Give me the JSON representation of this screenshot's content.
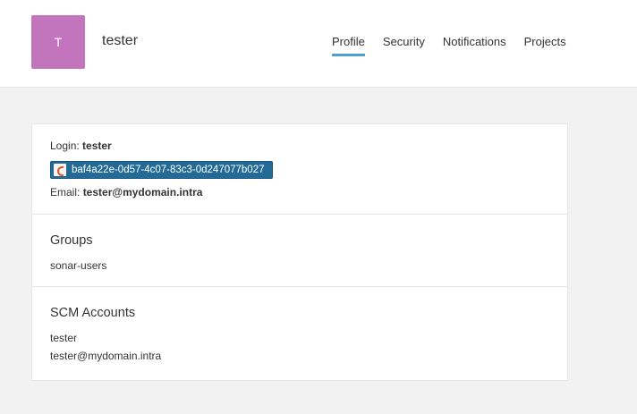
{
  "header": {
    "avatar_letter": "T",
    "avatar_color": "#c274bd",
    "username": "tester",
    "nav": [
      {
        "label": "Profile",
        "active": true
      },
      {
        "label": "Security",
        "active": false
      },
      {
        "label": "Notifications",
        "active": false
      },
      {
        "label": "Projects",
        "active": false
      }
    ],
    "accent_color": "#4b9fd5"
  },
  "profile": {
    "login_label": "Login: ",
    "login_value": "tester",
    "identity_provider_icon": "sonarqube-logo-icon",
    "external_id": "baf4a22e-0d57-4c07-83c3-0d247077b027",
    "email_label": "Email: ",
    "email_value": "tester@mydomain.intra"
  },
  "groups": {
    "title": "Groups",
    "items": [
      "sonar-users"
    ]
  },
  "scm": {
    "title": "SCM Accounts",
    "items": [
      "tester",
      "tester@mydomain.intra"
    ]
  }
}
